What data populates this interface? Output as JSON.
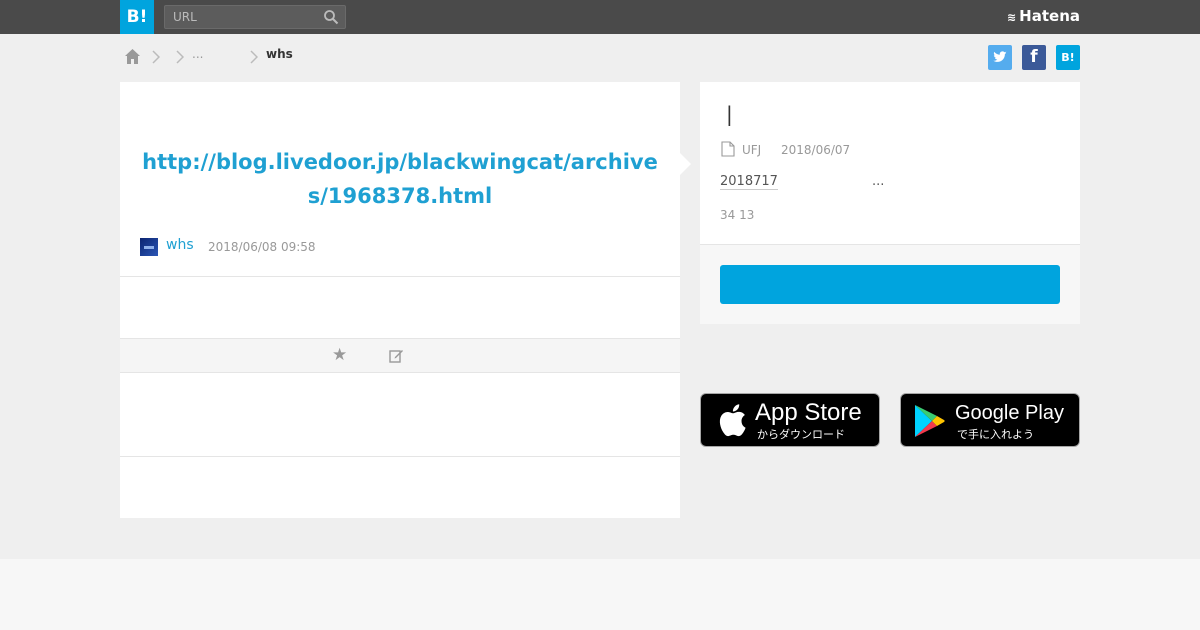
{
  "header": {
    "logo_label": "B!",
    "search_placeholder": "URL",
    "brand": "Hatena",
    "brand_mark": "≋"
  },
  "breadcrumb": {
    "items": [
      "",
      "...",
      "whs"
    ]
  },
  "share": {
    "twitter_label": "t",
    "facebook_label": "f",
    "hatena_label": "B!"
  },
  "entry": {
    "title": "http://blog.livedoor.jp/blackwingcat/archives/1968378.html",
    "username": "whs",
    "timestamp": "2018/06/08 09:58"
  },
  "side": {
    "title": "|",
    "source": "UFJ",
    "date": "2018/06/07",
    "summary_link": "2018717",
    "summary_rest": "...",
    "counts": "34 13"
  },
  "apps": {
    "appstore_big": "App Store",
    "appstore_small": "からダウンロード",
    "googleplay_big": "Google Play",
    "googleplay_small": "で手に入れよう"
  },
  "colors": {
    "accent": "#00a4de",
    "link": "#1fa0d2",
    "topbar": "#4a4a4a",
    "twitter": "#55acee",
    "facebook": "#3b5998"
  }
}
